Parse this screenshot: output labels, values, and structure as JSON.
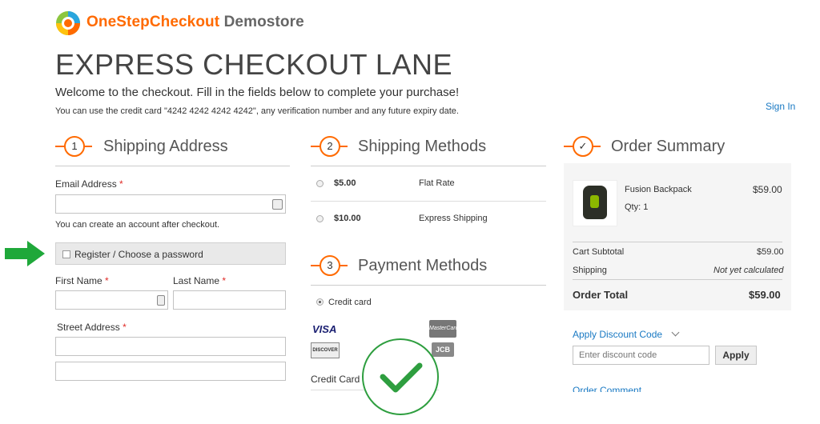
{
  "brand": {
    "name": "OneStepCheckout",
    "suffix": "Demostore"
  },
  "page": {
    "title": "EXPRESS CHECKOUT LANE",
    "welcome": "Welcome to the checkout. Fill in the fields below to complete your purchase!",
    "card_note": "You can use the credit card \"4242 4242 4242 4242\", any verification number and any future expiry date.",
    "sign_in": "Sign In"
  },
  "shipping_address": {
    "step": "1",
    "title": "Shipping Address",
    "email_label": "Email Address",
    "email_value": "",
    "account_hint": "You can create an account after checkout.",
    "register_label": "Register / Choose a password",
    "register_checked": false,
    "first_name_label": "First Name",
    "last_name_label": "Last Name",
    "street_label": "Street Address",
    "required_mark": "*"
  },
  "shipping_methods": {
    "step": "2",
    "title": "Shipping Methods",
    "options": [
      {
        "price": "$5.00",
        "name": "Flat Rate"
      },
      {
        "price": "$10.00",
        "name": "Express Shipping"
      }
    ]
  },
  "payment_methods": {
    "step": "3",
    "title": "Payment Methods",
    "option": "Credit card",
    "selected": true,
    "card_logos": {
      "visa": "VISA",
      "discover": "DISCOVER",
      "mastercard": "MasterCard",
      "jcb": "JCB"
    },
    "card_number_label": "Credit Card N"
  },
  "order_summary": {
    "step": "✓",
    "title": "Order Summary",
    "item": {
      "name": "Fusion Backpack",
      "qty": "Qty: 1",
      "price": "$59.00"
    },
    "cart_subtotal_label": "Cart Subtotal",
    "cart_subtotal": "$59.00",
    "shipping_label": "Shipping",
    "shipping_value": "Not yet calculated",
    "order_total_label": "Order Total",
    "order_total": "$59.00",
    "discount_link": "Apply Discount Code",
    "discount_placeholder": "Enter discount code",
    "apply_label": "Apply",
    "order_comment": "Order Comment"
  },
  "colors": {
    "accent": "#ff6a00",
    "link": "#1979c3",
    "arrow": "#1fa83a",
    "check": "#2e9e3f"
  },
  "icons": {
    "logo": "logo-icon",
    "arrow": "arrow-right-icon",
    "check": "checkmark-icon"
  }
}
